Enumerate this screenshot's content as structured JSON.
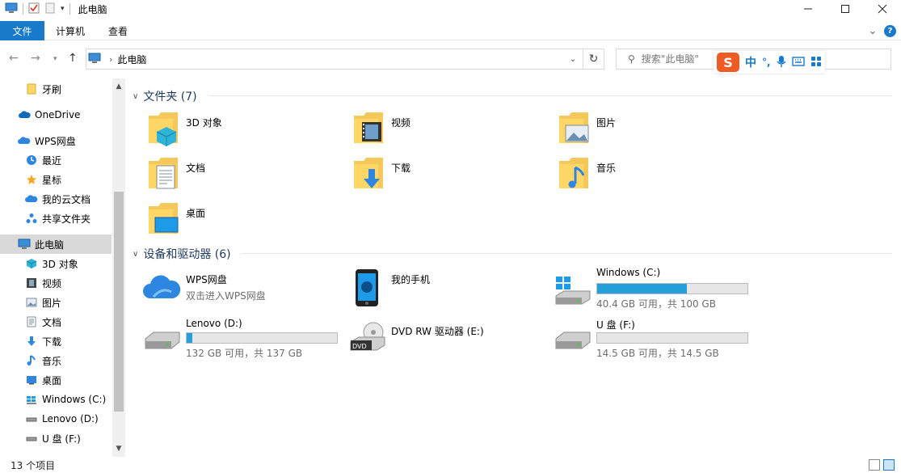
{
  "window": {
    "title": "此电脑"
  },
  "ribbon": {
    "tabs": [
      {
        "label": "文件"
      },
      {
        "label": "计算机"
      },
      {
        "label": "查看"
      }
    ]
  },
  "address": {
    "path": "此电脑"
  },
  "search": {
    "placeholder": "搜索\"此电脑\""
  },
  "ime": {
    "mode": "中",
    "punct": "°,"
  },
  "sidebar": {
    "items": [
      {
        "label": "牙刷",
        "icon": "folder-icon"
      },
      {
        "label": "OneDrive",
        "icon": "cloud-icon"
      },
      {
        "label": "WPS网盘",
        "icon": "wps-cloud-icon"
      },
      {
        "label": "最近",
        "icon": "clock-icon"
      },
      {
        "label": "星标",
        "icon": "star-icon"
      },
      {
        "label": "我的云文档",
        "icon": "cloud-doc-icon"
      },
      {
        "label": "共享文件夹",
        "icon": "share-icon"
      },
      {
        "label": "此电脑",
        "icon": "computer-icon"
      },
      {
        "label": "3D 对象",
        "icon": "cube-icon"
      },
      {
        "label": "视频",
        "icon": "film-icon"
      },
      {
        "label": "图片",
        "icon": "picture-icon"
      },
      {
        "label": "文档",
        "icon": "document-icon"
      },
      {
        "label": "下载",
        "icon": "download-icon"
      },
      {
        "label": "音乐",
        "icon": "music-icon"
      },
      {
        "label": "桌面",
        "icon": "desktop-icon"
      },
      {
        "label": "Windows (C:)",
        "icon": "windows-drive-icon"
      },
      {
        "label": "Lenovo (D:)",
        "icon": "drive-icon"
      },
      {
        "label": "U 盘 (F:)",
        "icon": "drive-icon"
      }
    ]
  },
  "folders_group": {
    "header": "文件夹 (7)"
  },
  "folders": [
    {
      "name": "3D 对象",
      "icon": "cube-folder-icon"
    },
    {
      "name": "视频",
      "icon": "video-folder-icon"
    },
    {
      "name": "图片",
      "icon": "picture-folder-icon"
    },
    {
      "name": "文档",
      "icon": "document-folder-icon"
    },
    {
      "name": "下载",
      "icon": "download-folder-icon"
    },
    {
      "name": "音乐",
      "icon": "music-folder-icon"
    },
    {
      "name": "桌面",
      "icon": "desktop-folder-icon"
    }
  ],
  "devices_group": {
    "header": "设备和驱动器 (6)"
  },
  "devices": [
    {
      "name": "WPS网盘",
      "subtitle": "双击进入WPS网盘",
      "icon": "wps-cloud-icon"
    },
    {
      "name": "我的手机",
      "icon": "phone-icon"
    },
    {
      "name": "Windows (C:)",
      "free": "40.4 GB 可用，共 100 GB",
      "used_fraction": 0.596,
      "icon": "windows-drive-icon"
    },
    {
      "name": "Lenovo (D:)",
      "free": "132 GB 可用，共 137 GB",
      "used_fraction": 0.036,
      "icon": "drive-icon"
    },
    {
      "name": "DVD RW 驱动器 (E:)",
      "icon": "dvd-drive-icon"
    },
    {
      "name": "U 盘 (F:)",
      "free": "14.5 GB 可用，共 14.5 GB",
      "used_fraction": 0.0,
      "icon": "usb-drive-icon"
    }
  ],
  "status": {
    "count": "13 个项目"
  },
  "colors": {
    "accent": "#1979ca",
    "bar_fill": "#26a0da",
    "header_text": "#1e395b"
  }
}
